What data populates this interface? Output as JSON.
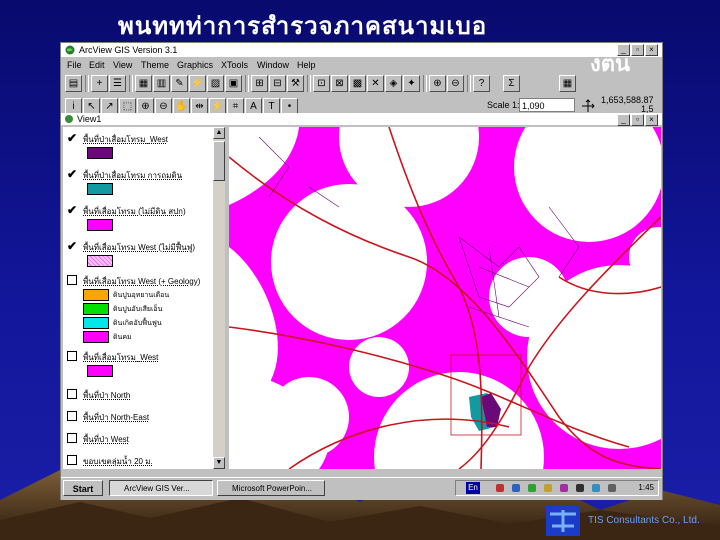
{
  "slide": {
    "title_line1": "พนททท่าการสำรวจภาคสนามเบอ",
    "title_line2": "งตน",
    "footer_text": "TIS Consultants Co., Ltd."
  },
  "app": {
    "title": "ArcView GIS Version 3.1",
    "menu": [
      "File",
      "Edit",
      "View",
      "Theme",
      "Graphics",
      "XTools",
      "Window",
      "Help"
    ],
    "scale_label": "Scale 1:",
    "scale_value": "1,090",
    "coord_x": "1,653,588.87",
    "coord_y": "1,5"
  },
  "view": {
    "title": "View1",
    "themes": [
      {
        "name": "พื้นที่ป่าเสื่อมโทรม_West",
        "checked": true,
        "color": "#6a0a78"
      },
      {
        "name": "พื้นที่ป่าเสื่อมโทรม การถมดิน",
        "checked": true,
        "color": "#139aa0"
      },
      {
        "name": "พื้นที่เสื่อมโทรม (ไม่มีดิน สปก)",
        "checked": true,
        "color": "#ff00ff"
      },
      {
        "name": "พื้นที่เสื่อมโทรม West (ไม่มีฟื้นฟู)",
        "checked": true,
        "color": "#ffc0ff"
      },
      {
        "name": "พื้นที่เสื่อมโทรม West (+ Geology)",
        "checked": false,
        "color": ""
      },
      {
        "name": "พื้นที่เสื่อมโทรม_West",
        "checked": false,
        "color": "#ff00ff"
      },
      {
        "name": "พื้นที่ป่า North",
        "checked": false,
        "color": ""
      },
      {
        "name": "พื้นที่ป่า North-East",
        "checked": false,
        "color": ""
      },
      {
        "name": "พื้นที่ป่า West",
        "checked": false,
        "color": ""
      },
      {
        "name": "ขอบเขตลุ่มน้ำ 20 ม.",
        "checked": false,
        "color": ""
      }
    ],
    "legend_subitems": [
      {
        "label": "ดินปูนอุทยานเดือน",
        "color": "#ffa500"
      },
      {
        "label": "ดินปูนอับเสียเอ็น",
        "color": "#00e000"
      },
      {
        "label": "ดินเกิดอับฟื้นฟูน",
        "color": "#00e8e8"
      },
      {
        "label": "ดินคม",
        "color": "#ff00ff"
      }
    ]
  },
  "taskbar": {
    "start": "Start",
    "tasks": [
      "ArcView GIS Ver...",
      "Microsoft PowerPoin..."
    ],
    "lang": "En",
    "clock": "1:45"
  }
}
